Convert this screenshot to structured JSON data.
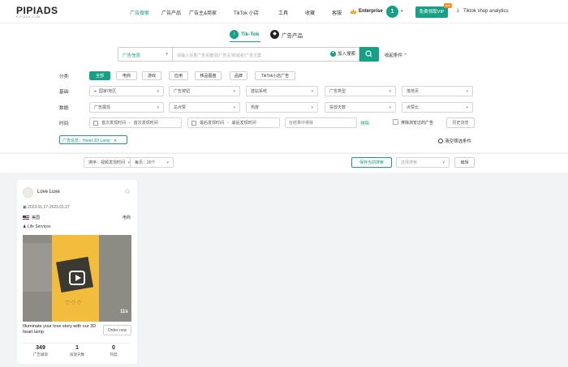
{
  "brand": {
    "logo": "PIPIADS",
    "sub": "PIPIADS.COM"
  },
  "nav": {
    "items": [
      "广告搜索",
      "广告产品",
      "广告主&商家",
      "TikTok 小店",
      "工具",
      "收藏",
      "客服"
    ],
    "enterprise": "Enterprise",
    "avatar": "1",
    "vip": "免费领取VIP",
    "vip_badge": "new",
    "analytics": "Tiktok shop analytics"
  },
  "platforms": [
    "Tik-Tok",
    "广告产品"
  ],
  "search": {
    "category": "广告信息",
    "placeholder": "请输入任意广告关键词/广告主/商城名/广告文案",
    "add": "加入搜索",
    "collect": "收起条件"
  },
  "filters": {
    "category_label": "分类:",
    "categories": [
      "全部",
      "电商",
      "游戏",
      "应用",
      "移品图盘",
      "品牌",
      "TikTok小店广告"
    ],
    "basic_label": "基础:",
    "basic": [
      "国家/地区",
      "广告按钮",
      "建站系统",
      "广告类型",
      "落地页"
    ],
    "data_label": "数据:",
    "data": [
      "广告展现",
      "总点赞",
      "热度",
      "投放天数",
      "点赞比"
    ],
    "time_label": "时间:",
    "first_start": "首次发现时间",
    "first_end": "首次发现时间",
    "last_start": "最后发现时间",
    "last_end": "最后发现时间",
    "exclude_placeholder": "在结果中排除",
    "exclude_btn": "排除",
    "exclude_seen": "排除浏览过的广告",
    "history": "历史浏览"
  },
  "active_tag": "广告信息：Heart 3D Lamp",
  "clear_filters": "清空筛选条件",
  "toolbar": {
    "sort": "排序：视频发现时间",
    "per_page": "每页：20个",
    "save": "保存当前搜索",
    "saved_placeholder": "选择搜索",
    "edit": "编辑"
  },
  "card": {
    "name": "Love Luxe",
    "dates": "2023.01.27-2023.01.27",
    "country": "美国",
    "type": "电商",
    "category": "Life Services",
    "duration": "11s",
    "caption": "Illuminate your love story with our 3D heart lamp",
    "cta": "Order now",
    "stats": [
      {
        "value": "349",
        "label": "广告展现"
      },
      {
        "value": "1",
        "label": "投放天数"
      },
      {
        "value": "0",
        "label": "热度"
      }
    ]
  },
  "colors": {
    "accent": "#16a085",
    "vip_badge": "#ff8c1a",
    "poster": "#f2bc3c"
  }
}
